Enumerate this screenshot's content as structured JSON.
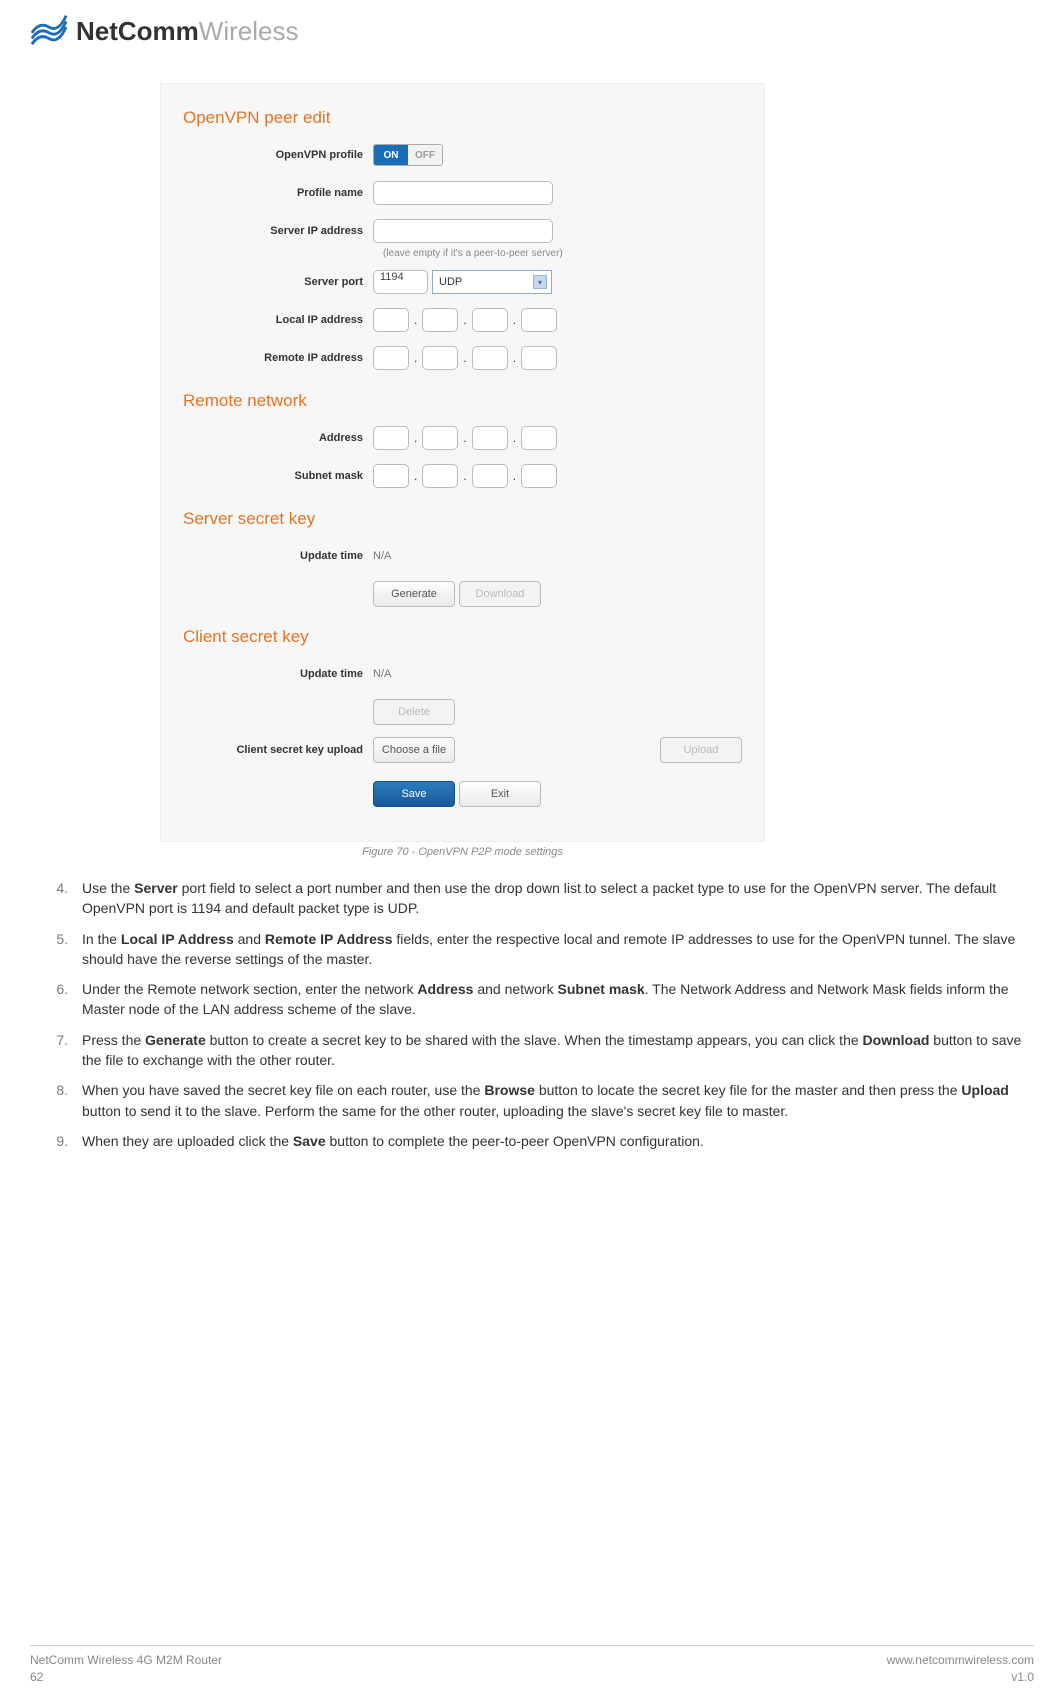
{
  "logo": {
    "bold": "NetComm",
    "light": "Wireless"
  },
  "panel": {
    "section1": "OpenVPN peer edit",
    "rows": {
      "profile": {
        "label": "OpenVPN profile",
        "on": "ON",
        "off": "OFF"
      },
      "name": {
        "label": "Profile name"
      },
      "server": {
        "label": "Server IP address",
        "hint": "(leave empty if it's a peer-to-peer server)"
      },
      "port": {
        "label": "Server port",
        "value": "1194",
        "proto": "UDP"
      },
      "local": {
        "label": "Local IP address"
      },
      "remote": {
        "label": "Remote IP address"
      }
    },
    "section2": "Remote network",
    "net": {
      "addr": {
        "label": "Address"
      },
      "mask": {
        "label": "Subnet mask"
      }
    },
    "section3": "Server secret key",
    "srv": {
      "update_label": "Update time",
      "update_value": "N/A",
      "generate": "Generate",
      "download": "Download"
    },
    "section4": "Client secret key",
    "cli": {
      "update_label": "Update time",
      "update_value": "N/A",
      "delete": "Delete",
      "upload_label": "Client secret key upload",
      "choose": "Choose a file",
      "upload": "Upload"
    },
    "save": "Save",
    "exit": "Exit"
  },
  "caption": "Figure 70 - OpenVPN P2P mode settings",
  "steps": {
    "s4": {
      "num": "4.",
      "a": "Use the ",
      "b": "Server",
      "c": " port field to select a port number and then use the drop down list to select a packet type to use for the OpenVPN server. The default OpenVPN port is 1194 and default packet type is UDP."
    },
    "s5": {
      "num": "5.",
      "a": "In the ",
      "b": "Local IP Address",
      "c": " and ",
      "d": "Remote IP Address",
      "e": " fields, enter the respective local and remote IP addresses to use for the OpenVPN tunnel. The slave should have the reverse settings of the master."
    },
    "s6": {
      "num": "6.",
      "a": "Under the Remote network section, enter the network ",
      "b": "Address",
      "c": " and network ",
      "d": "Subnet mask",
      "e": ". The Network Address and Network Mask fields inform the Master node of the LAN address scheme of the slave."
    },
    "s7": {
      "num": "7.",
      "a": "Press the ",
      "b": "Generate",
      "c": " button to create a secret key to be shared with the slave. When the timestamp appears, you can click the ",
      "d": "Download",
      "e": " button to save the file to exchange with the other router."
    },
    "s8": {
      "num": "8.",
      "a": "When you have saved the secret key file on each router, use the ",
      "b": "Browse",
      "c": " button to locate the secret key file for the master and then press the ",
      "d": "Upload",
      "e": " button to send it to the slave. Perform the same for the other router, uploading the slave's secret key file to master."
    },
    "s9": {
      "num": "9.",
      "a": "When they are uploaded click the ",
      "b": "Save",
      "c": " button to complete the peer-to-peer OpenVPN configuration."
    }
  },
  "footer": {
    "left1": "NetComm Wireless 4G M2M Router",
    "left2": "62",
    "right1": "www.netcommwireless.com",
    "right2": "v1.0"
  }
}
